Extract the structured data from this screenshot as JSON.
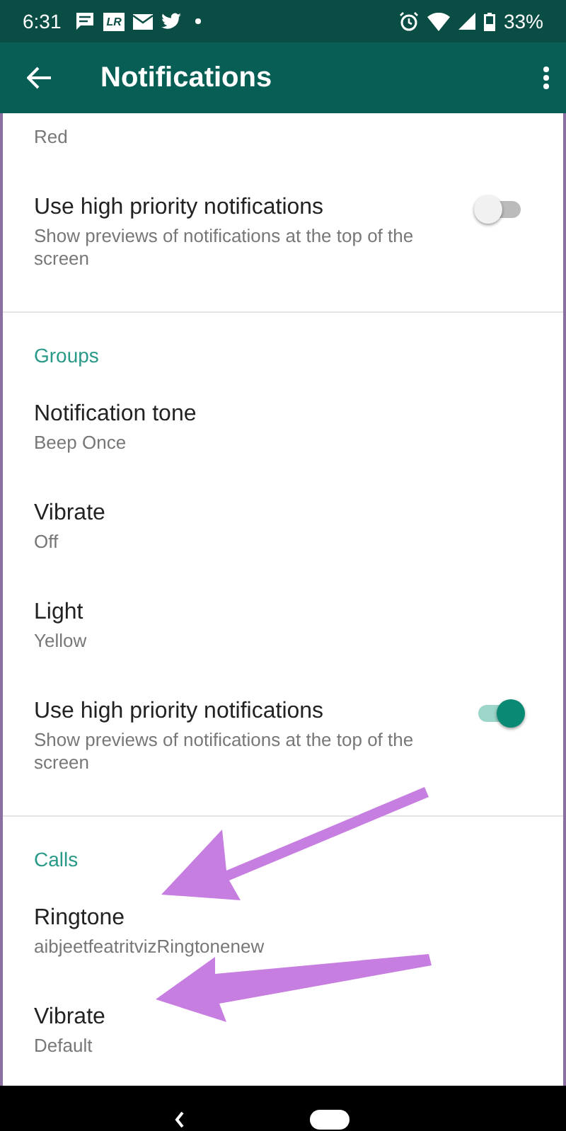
{
  "status_bar": {
    "time": "6:31",
    "app_badge": "LR",
    "battery": "33%"
  },
  "toolbar": {
    "title": "Notifications"
  },
  "sections": [
    {
      "items": [
        {
          "kind": "value",
          "subtitle": "Red"
        },
        {
          "kind": "toggle",
          "title": "Use high priority notifications",
          "subtitle": "Show previews of notifications at the top of the screen",
          "on": false
        }
      ]
    },
    {
      "header": "Groups",
      "items": [
        {
          "kind": "value",
          "title": "Notification tone",
          "subtitle": "Beep Once"
        },
        {
          "kind": "value",
          "title": "Vibrate",
          "subtitle": "Off"
        },
        {
          "kind": "value",
          "title": "Light",
          "subtitle": "Yellow"
        },
        {
          "kind": "toggle",
          "title": "Use high priority notifications",
          "subtitle": "Show previews of notifications at the top of the screen",
          "on": true
        }
      ]
    },
    {
      "header": "Calls",
      "items": [
        {
          "kind": "value",
          "title": "Ringtone",
          "subtitle": "aibjeetfeatritvizRingtonenew"
        },
        {
          "kind": "value",
          "title": "Vibrate",
          "subtitle": "Default"
        }
      ]
    }
  ]
}
